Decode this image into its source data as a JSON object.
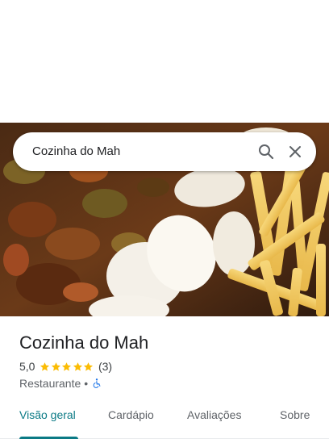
{
  "search": {
    "query": "Cozinha do Mah"
  },
  "place": {
    "name": "Cozinha do Mah",
    "rating": "5,0",
    "stars": 5,
    "reviews": "(3)",
    "category": "Restaurante",
    "separator": "•",
    "wheelchair_accessible": true
  },
  "tabs": [
    {
      "label": "Visão geral",
      "active": true
    },
    {
      "label": "Cardápio",
      "active": false
    },
    {
      "label": "Avaliações",
      "active": false
    },
    {
      "label": "Sobre",
      "active": false
    }
  ],
  "colors": {
    "accent": "#0b7a85",
    "star": "#fbbc04",
    "access": "#1a73e8"
  }
}
